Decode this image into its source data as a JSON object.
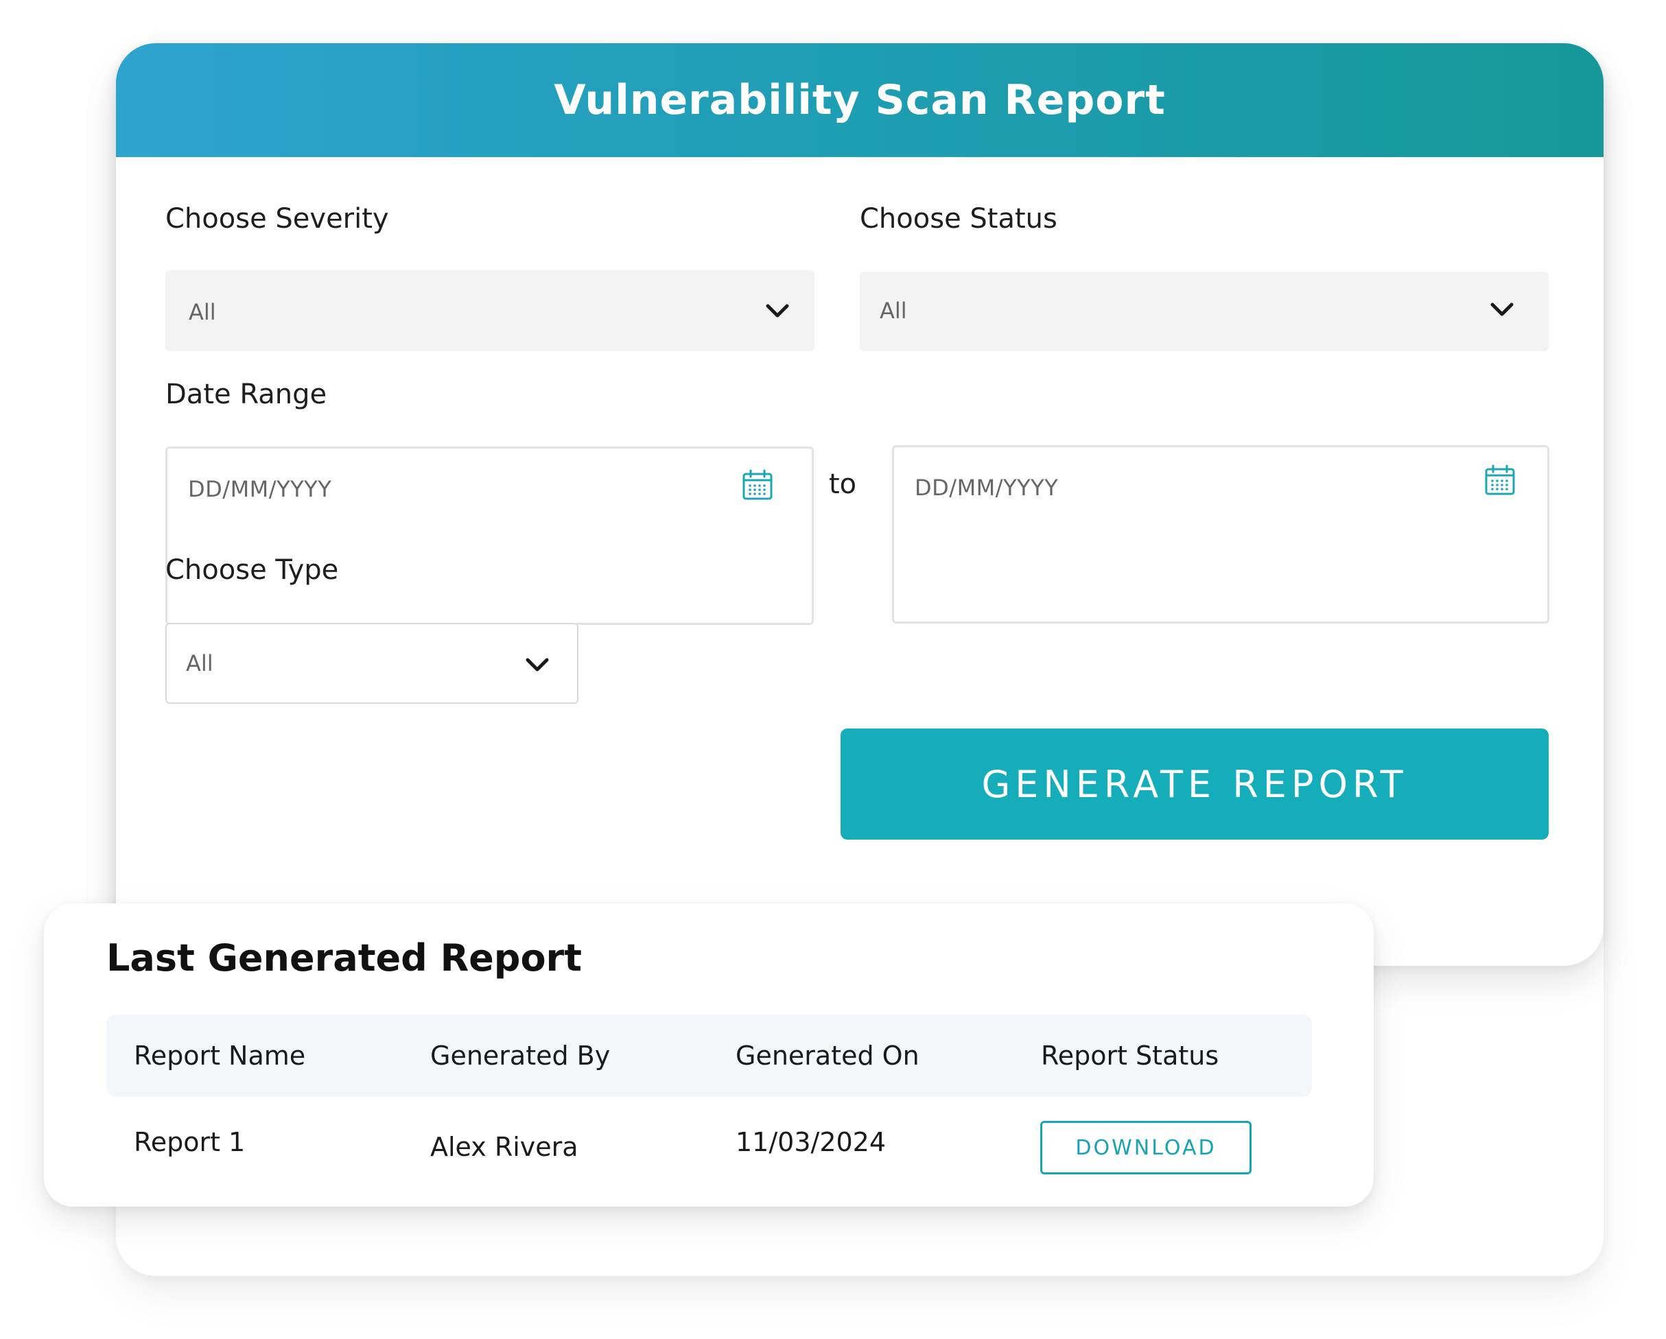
{
  "header": {
    "title": "Vulnerability Scan Report"
  },
  "filters": {
    "severity": {
      "label": "Choose Severity",
      "value": "All"
    },
    "status": {
      "label": "Choose Status",
      "value": "All"
    },
    "date_range": {
      "label": "Date Range",
      "from_placeholder": "DD/MM/YYYY",
      "separator": "to",
      "to_placeholder": "DD/MM/YYYY"
    },
    "type": {
      "label": "Choose Type",
      "value": "All"
    }
  },
  "actions": {
    "generate_label": "GENERATE REPORT"
  },
  "last_report": {
    "title": "Last Generated Report",
    "columns": [
      "Report Name",
      "Generated By",
      "Generated On",
      "Report Status"
    ],
    "rows": [
      {
        "name": "Report 1",
        "generated_by": "Alex Rivera",
        "generated_on": "11/03/2024",
        "status_action": "DOWNLOAD"
      }
    ]
  },
  "colors": {
    "accent": "#15adb9",
    "header_gradient_start": "#2ea3cf",
    "header_gradient_end": "#16989a"
  },
  "icons": {
    "dropdown": "chevron-down-icon",
    "date": "calendar-icon"
  }
}
